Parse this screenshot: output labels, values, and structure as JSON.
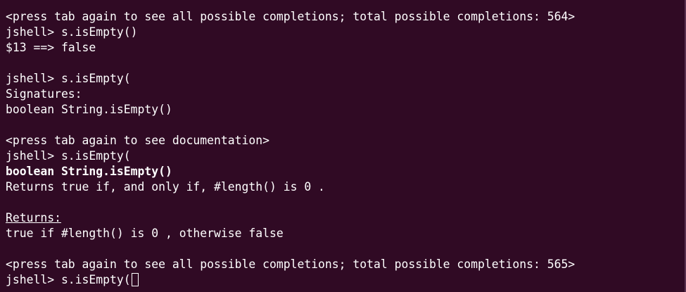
{
  "terminal": {
    "lines": [
      "<press tab again to see all possible completions; total possible completions: 564>",
      "jshell> s.isEmpty()",
      "$13 ==> false",
      "",
      "jshell> s.isEmpty(",
      "Signatures:",
      "boolean String.isEmpty()",
      "",
      "<press tab again to see documentation>",
      "jshell> s.isEmpty(",
      "boolean String.isEmpty()",
      "Returns true if, and only if, #length() is 0 .",
      "",
      "Returns:",
      "true if #length() is 0 , otherwise false",
      "",
      "<press tab again to see all possible completions; total possible completions: 565>",
      "jshell> s.isEmpty("
    ]
  },
  "colors": {
    "background": "#300a24",
    "text": "#ffffff"
  }
}
